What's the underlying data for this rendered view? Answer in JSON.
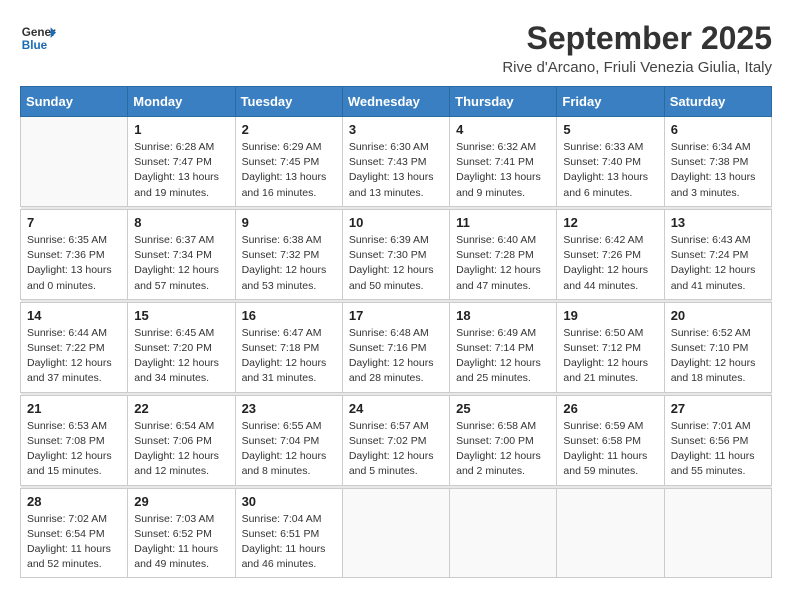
{
  "logo": {
    "line1": "General",
    "line2": "Blue"
  },
  "title": "September 2025",
  "subtitle": "Rive d'Arcano, Friuli Venezia Giulia, Italy",
  "days_of_week": [
    "Sunday",
    "Monday",
    "Tuesday",
    "Wednesday",
    "Thursday",
    "Friday",
    "Saturday"
  ],
  "weeks": [
    [
      {
        "day": "",
        "sunrise": "",
        "sunset": "",
        "daylight": ""
      },
      {
        "day": "1",
        "sunrise": "Sunrise: 6:28 AM",
        "sunset": "Sunset: 7:47 PM",
        "daylight": "Daylight: 13 hours and 19 minutes."
      },
      {
        "day": "2",
        "sunrise": "Sunrise: 6:29 AM",
        "sunset": "Sunset: 7:45 PM",
        "daylight": "Daylight: 13 hours and 16 minutes."
      },
      {
        "day": "3",
        "sunrise": "Sunrise: 6:30 AM",
        "sunset": "Sunset: 7:43 PM",
        "daylight": "Daylight: 13 hours and 13 minutes."
      },
      {
        "day": "4",
        "sunrise": "Sunrise: 6:32 AM",
        "sunset": "Sunset: 7:41 PM",
        "daylight": "Daylight: 13 hours and 9 minutes."
      },
      {
        "day": "5",
        "sunrise": "Sunrise: 6:33 AM",
        "sunset": "Sunset: 7:40 PM",
        "daylight": "Daylight: 13 hours and 6 minutes."
      },
      {
        "day": "6",
        "sunrise": "Sunrise: 6:34 AM",
        "sunset": "Sunset: 7:38 PM",
        "daylight": "Daylight: 13 hours and 3 minutes."
      }
    ],
    [
      {
        "day": "7",
        "sunrise": "Sunrise: 6:35 AM",
        "sunset": "Sunset: 7:36 PM",
        "daylight": "Daylight: 13 hours and 0 minutes."
      },
      {
        "day": "8",
        "sunrise": "Sunrise: 6:37 AM",
        "sunset": "Sunset: 7:34 PM",
        "daylight": "Daylight: 12 hours and 57 minutes."
      },
      {
        "day": "9",
        "sunrise": "Sunrise: 6:38 AM",
        "sunset": "Sunset: 7:32 PM",
        "daylight": "Daylight: 12 hours and 53 minutes."
      },
      {
        "day": "10",
        "sunrise": "Sunrise: 6:39 AM",
        "sunset": "Sunset: 7:30 PM",
        "daylight": "Daylight: 12 hours and 50 minutes."
      },
      {
        "day": "11",
        "sunrise": "Sunrise: 6:40 AM",
        "sunset": "Sunset: 7:28 PM",
        "daylight": "Daylight: 12 hours and 47 minutes."
      },
      {
        "day": "12",
        "sunrise": "Sunrise: 6:42 AM",
        "sunset": "Sunset: 7:26 PM",
        "daylight": "Daylight: 12 hours and 44 minutes."
      },
      {
        "day": "13",
        "sunrise": "Sunrise: 6:43 AM",
        "sunset": "Sunset: 7:24 PM",
        "daylight": "Daylight: 12 hours and 41 minutes."
      }
    ],
    [
      {
        "day": "14",
        "sunrise": "Sunrise: 6:44 AM",
        "sunset": "Sunset: 7:22 PM",
        "daylight": "Daylight: 12 hours and 37 minutes."
      },
      {
        "day": "15",
        "sunrise": "Sunrise: 6:45 AM",
        "sunset": "Sunset: 7:20 PM",
        "daylight": "Daylight: 12 hours and 34 minutes."
      },
      {
        "day": "16",
        "sunrise": "Sunrise: 6:47 AM",
        "sunset": "Sunset: 7:18 PM",
        "daylight": "Daylight: 12 hours and 31 minutes."
      },
      {
        "day": "17",
        "sunrise": "Sunrise: 6:48 AM",
        "sunset": "Sunset: 7:16 PM",
        "daylight": "Daylight: 12 hours and 28 minutes."
      },
      {
        "day": "18",
        "sunrise": "Sunrise: 6:49 AM",
        "sunset": "Sunset: 7:14 PM",
        "daylight": "Daylight: 12 hours and 25 minutes."
      },
      {
        "day": "19",
        "sunrise": "Sunrise: 6:50 AM",
        "sunset": "Sunset: 7:12 PM",
        "daylight": "Daylight: 12 hours and 21 minutes."
      },
      {
        "day": "20",
        "sunrise": "Sunrise: 6:52 AM",
        "sunset": "Sunset: 7:10 PM",
        "daylight": "Daylight: 12 hours and 18 minutes."
      }
    ],
    [
      {
        "day": "21",
        "sunrise": "Sunrise: 6:53 AM",
        "sunset": "Sunset: 7:08 PM",
        "daylight": "Daylight: 12 hours and 15 minutes."
      },
      {
        "day": "22",
        "sunrise": "Sunrise: 6:54 AM",
        "sunset": "Sunset: 7:06 PM",
        "daylight": "Daylight: 12 hours and 12 minutes."
      },
      {
        "day": "23",
        "sunrise": "Sunrise: 6:55 AM",
        "sunset": "Sunset: 7:04 PM",
        "daylight": "Daylight: 12 hours and 8 minutes."
      },
      {
        "day": "24",
        "sunrise": "Sunrise: 6:57 AM",
        "sunset": "Sunset: 7:02 PM",
        "daylight": "Daylight: 12 hours and 5 minutes."
      },
      {
        "day": "25",
        "sunrise": "Sunrise: 6:58 AM",
        "sunset": "Sunset: 7:00 PM",
        "daylight": "Daylight: 12 hours and 2 minutes."
      },
      {
        "day": "26",
        "sunrise": "Sunrise: 6:59 AM",
        "sunset": "Sunset: 6:58 PM",
        "daylight": "Daylight: 11 hours and 59 minutes."
      },
      {
        "day": "27",
        "sunrise": "Sunrise: 7:01 AM",
        "sunset": "Sunset: 6:56 PM",
        "daylight": "Daylight: 11 hours and 55 minutes."
      }
    ],
    [
      {
        "day": "28",
        "sunrise": "Sunrise: 7:02 AM",
        "sunset": "Sunset: 6:54 PM",
        "daylight": "Daylight: 11 hours and 52 minutes."
      },
      {
        "day": "29",
        "sunrise": "Sunrise: 7:03 AM",
        "sunset": "Sunset: 6:52 PM",
        "daylight": "Daylight: 11 hours and 49 minutes."
      },
      {
        "day": "30",
        "sunrise": "Sunrise: 7:04 AM",
        "sunset": "Sunset: 6:51 PM",
        "daylight": "Daylight: 11 hours and 46 minutes."
      },
      {
        "day": "",
        "sunrise": "",
        "sunset": "",
        "daylight": ""
      },
      {
        "day": "",
        "sunrise": "",
        "sunset": "",
        "daylight": ""
      },
      {
        "day": "",
        "sunrise": "",
        "sunset": "",
        "daylight": ""
      },
      {
        "day": "",
        "sunrise": "",
        "sunset": "",
        "daylight": ""
      }
    ]
  ]
}
